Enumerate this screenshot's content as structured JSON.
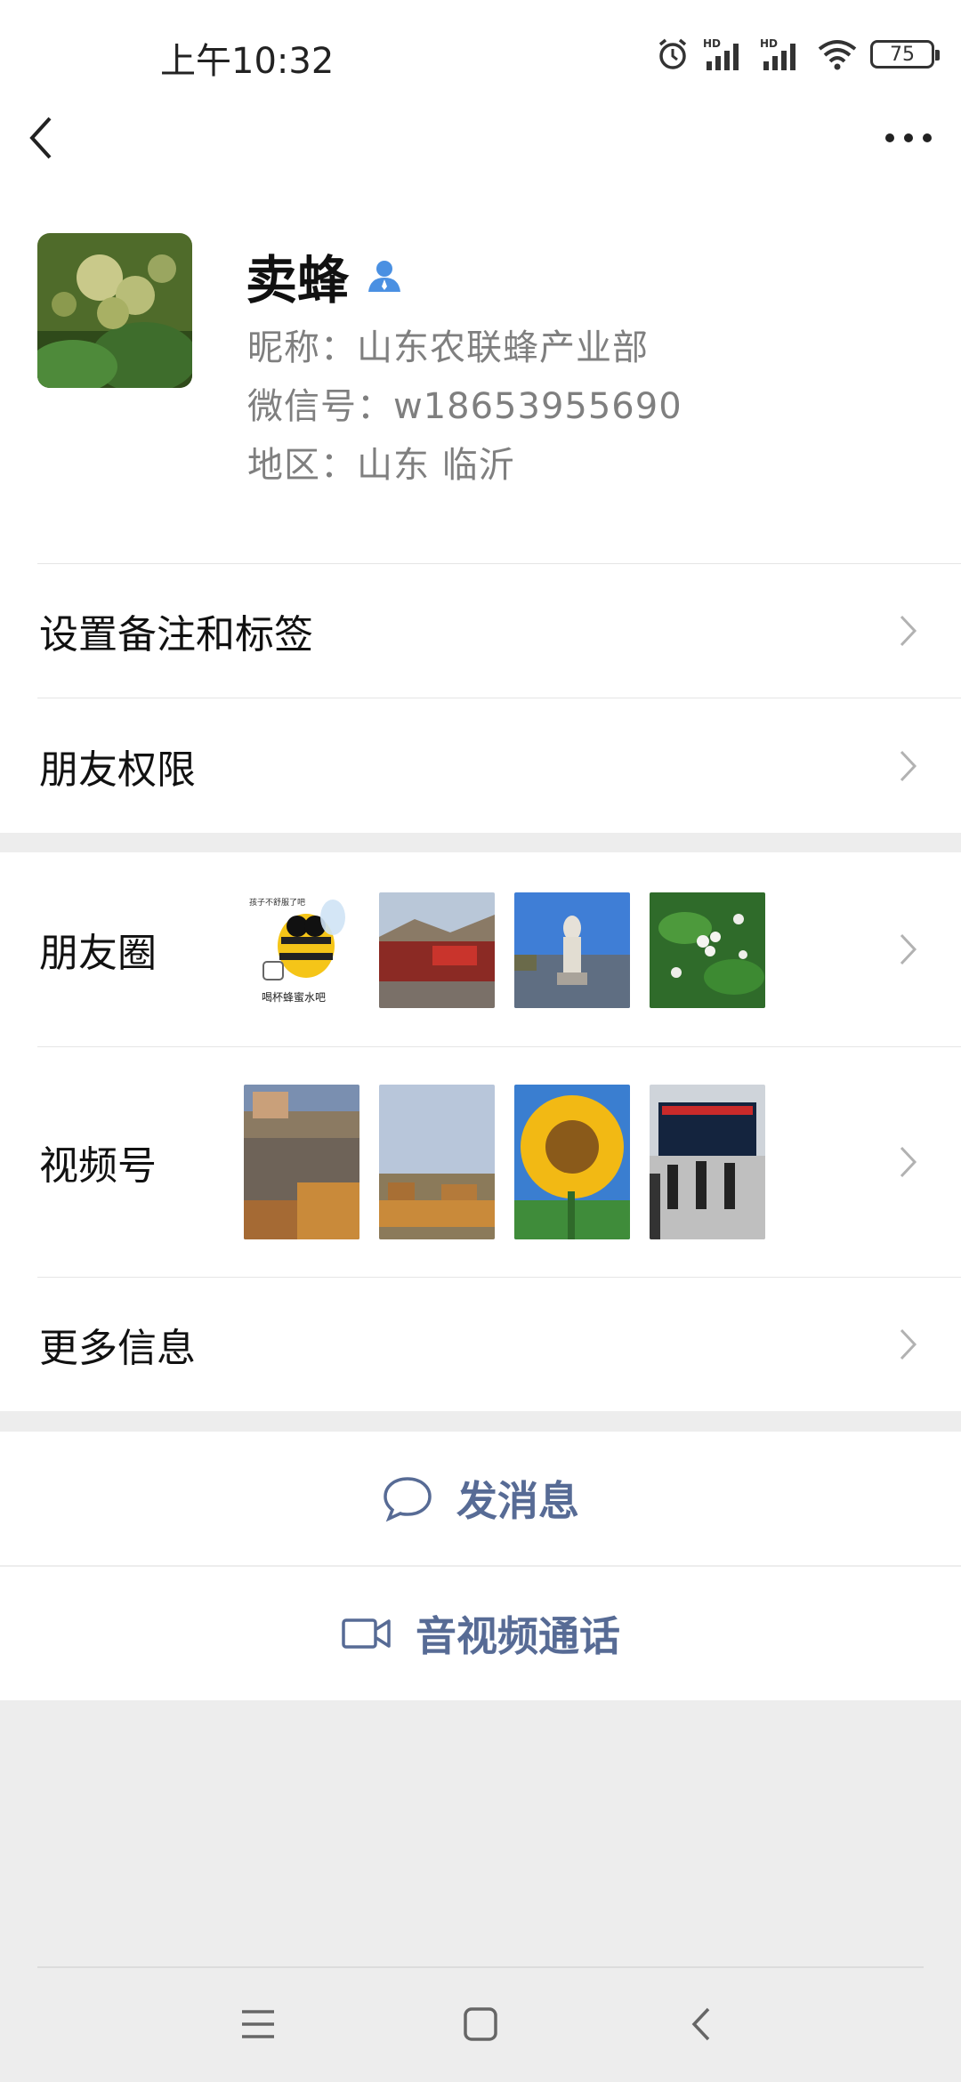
{
  "status_bar": {
    "time": "上午10:32",
    "battery": "75",
    "icons": [
      "alarm-icon",
      "signal-hd-icon",
      "signal-hd-icon",
      "wifi-icon",
      "battery-icon"
    ]
  },
  "header": {
    "back_icon": "chevron-left-icon",
    "more_icon": "more-dots-icon"
  },
  "profile": {
    "name": "卖蜂",
    "badge_icon": "person-icon",
    "nickname": "昵称：山东农联蜂产业部",
    "wechat_id": "微信号：w18653955690",
    "region": "地区：山东  临沂"
  },
  "menu": {
    "remark_tags": "设置备注和标签",
    "permissions": "朋友权限",
    "moments": "朋友圈",
    "channels": "视频号",
    "more_info": "更多信息"
  },
  "moments_thumbs": [
    {
      "caption_top": "孩子不舒服了吧",
      "caption_bottom": "喝杯蜂蜜水吧",
      "icon": "cartoon-bee-icon"
    },
    {
      "icon": "red-wall-photo"
    },
    {
      "icon": "statue-photo"
    },
    {
      "icon": "white-flowers-photo"
    }
  ],
  "channels_thumbs": [
    {
      "icon": "beehives-photo"
    },
    {
      "icon": "beehive-field-photo"
    },
    {
      "icon": "sunflower-photo"
    },
    {
      "icon": "meeting-hall-photo"
    }
  ],
  "actions": {
    "message": "发消息",
    "call": "音视频通话"
  },
  "colors": {
    "link": "#576b95",
    "badge": "#4a90e2",
    "background": "#ededed"
  }
}
